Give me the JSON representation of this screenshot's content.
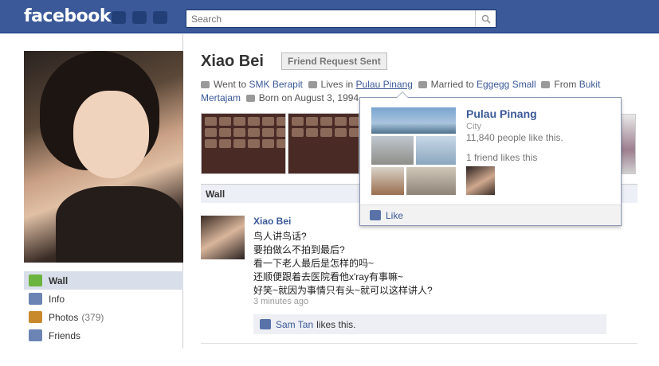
{
  "header": {
    "logo": "facebook",
    "search_placeholder": "Search",
    "icons": [
      "friends-icon",
      "messages-icon",
      "notifications-icon"
    ]
  },
  "profile": {
    "name": "Xiao Bei",
    "friend_button": "Friend Request Sent",
    "info": {
      "went_to_label": "Went to",
      "school": "SMK Berapit",
      "lives_label": "Lives in",
      "city": "Pulau Pinang",
      "married_label": "Married to",
      "spouse": "Eggegg Small",
      "from_label": "From",
      "from_place_1": "Bukit",
      "from_place_2": "Mertajam",
      "born": "Born on August 3, 1994"
    }
  },
  "sidebar": {
    "items": [
      {
        "label": "Wall",
        "icon": "wall-icon",
        "active": true
      },
      {
        "label": "Info",
        "icon": "info-icon"
      },
      {
        "label": "Photos",
        "count": "(379)",
        "icon": "photos-icon"
      },
      {
        "label": "Friends",
        "icon": "friends-icon"
      }
    ]
  },
  "wall": {
    "header": "Wall",
    "post": {
      "author": "Xiao Bei",
      "lines": [
        "鸟人讲鸟话?",
        "要拍做么不拍到最后?",
        "看一下老人最后是怎样的吗~",
        "还顺便跟着去医院看他x'ray有事嘛~",
        "好笑~就因为事情只有头~就可以这样讲人?"
      ],
      "time": "3 minutes ago",
      "liker": "Sam Tan",
      "likes_text": "likes this."
    }
  },
  "hovercard": {
    "title": "Pulau Pinang",
    "category": "City",
    "likes": "11,840 people like this.",
    "friends": "1 friend likes this",
    "like_button": "Like"
  }
}
